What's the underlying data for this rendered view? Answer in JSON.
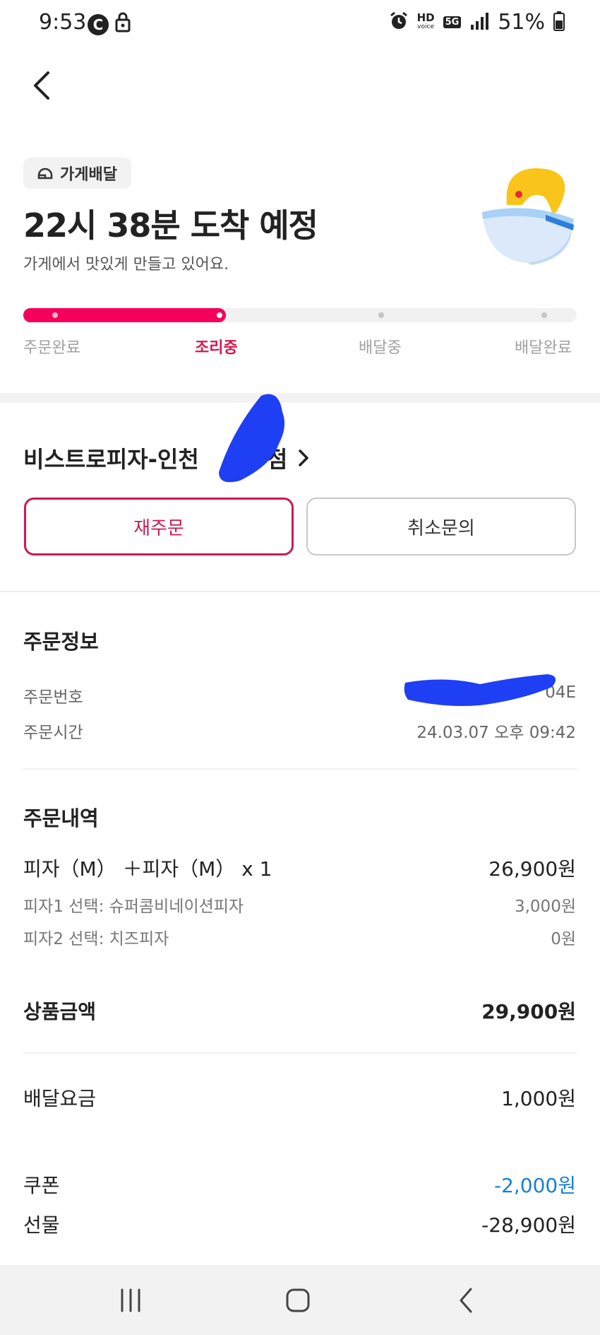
{
  "status_bar": {
    "time": "9:53",
    "c_badge": "C",
    "hd_label": "HD",
    "voice_label": "voice",
    "network": "5G",
    "battery": "51%"
  },
  "header": {
    "badge_label": "가게배달",
    "eta_title": "22시 38분 도착 예정",
    "eta_subtitle": "가게에서 맛있게 만들고 있어요."
  },
  "progress": {
    "steps": [
      "주문완료",
      "조리중",
      "배달중",
      "배달완료"
    ],
    "active_index": 1,
    "accent_color": "#f5005a",
    "active_label_color": "#d6174d"
  },
  "store": {
    "name": "비스트로피자-인천",
    "name_suffix": "점"
  },
  "actions": {
    "reorder_label": "재주문",
    "cancel_label": "취소문의"
  },
  "order_info": {
    "title": "주문정보",
    "number_label": "주문번호",
    "number_value_partial": "04E",
    "time_label": "주문시간",
    "time_value": "24.03.07 오후 09:42"
  },
  "order_items": {
    "title": "주문내역",
    "item_name": "피자（M） ＋피자（M） x 1",
    "item_price": "26,900원",
    "options": [
      {
        "label": "피자1 선택: 슈퍼콤비네이션피자",
        "value": "3,000원"
      },
      {
        "label": "피자2 선택: 치즈피자",
        "value": "0원"
      }
    ]
  },
  "totals": {
    "product_label": "상품금액",
    "product_value": "29,900원",
    "delivery_label": "배달요금",
    "delivery_value": "1,000원",
    "coupon_label": "쿠폰",
    "coupon_value": "-2,000원",
    "gift_label": "선물",
    "gift_value": "-28,900원"
  },
  "nav": {
    "icons": [
      "recents-icon",
      "home-icon",
      "back-nav-icon"
    ]
  }
}
